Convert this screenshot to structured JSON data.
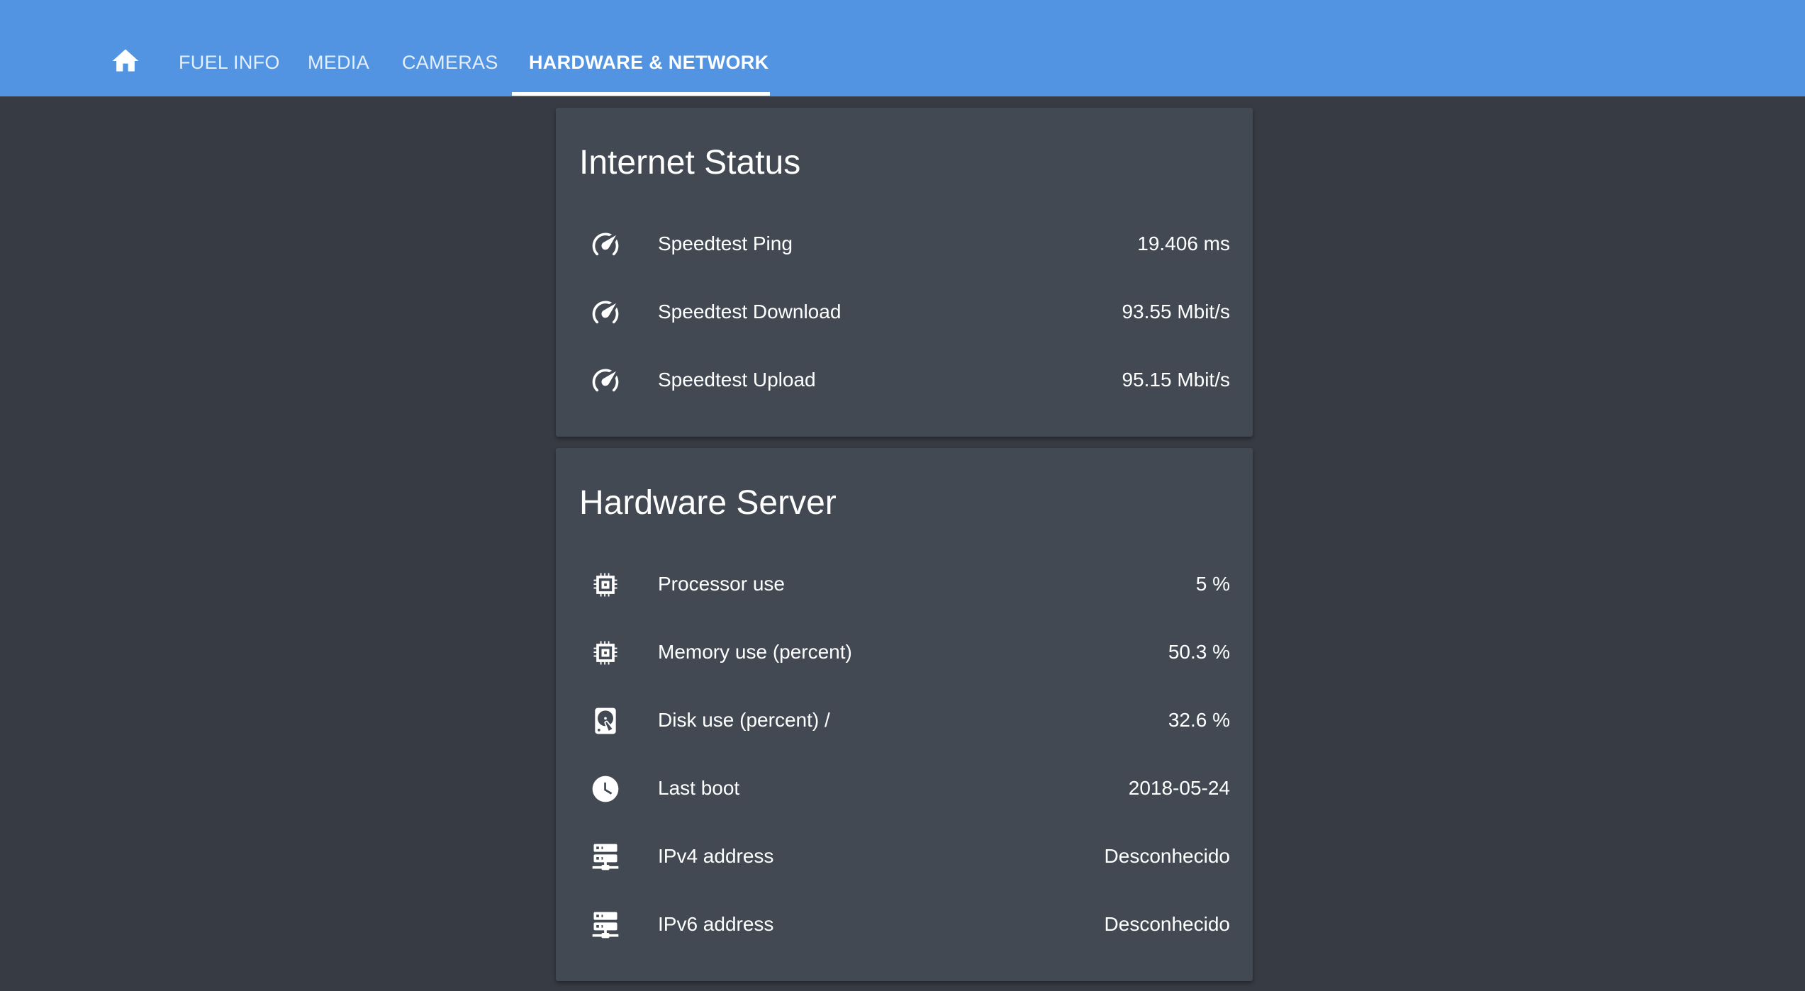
{
  "nav": {
    "home_icon": "home-icon",
    "tabs": [
      {
        "label": "FUEL INFO"
      },
      {
        "label": "MEDIA"
      },
      {
        "label": "CAMERAS"
      },
      {
        "label": "HARDWARE & NETWORK",
        "active": true
      }
    ]
  },
  "colors": {
    "header": "#5294e2",
    "background": "#373b43",
    "card": "#434953"
  },
  "internet_status": {
    "title": "Internet Status",
    "rows": [
      {
        "icon": "speedometer-icon",
        "label": "Speedtest Ping",
        "value": "19.406 ms"
      },
      {
        "icon": "speedometer-icon",
        "label": "Speedtest Download",
        "value": "93.55 Mbit/s"
      },
      {
        "icon": "speedometer-icon",
        "label": "Speedtest Upload",
        "value": "95.15 Mbit/s"
      }
    ]
  },
  "hardware_server": {
    "title": "Hardware Server",
    "rows": [
      {
        "icon": "chip-icon",
        "label": "Processor use",
        "value": "5 %"
      },
      {
        "icon": "chip-icon",
        "label": "Memory use (percent)",
        "value": "50.3 %"
      },
      {
        "icon": "harddisk-icon",
        "label": "Disk use (percent) /",
        "value": "32.6 %"
      },
      {
        "icon": "clock-icon",
        "label": "Last boot",
        "value": "2018-05-24"
      },
      {
        "icon": "server-network-icon",
        "label": "IPv4 address",
        "value": "Desconhecido"
      },
      {
        "icon": "server-network-icon",
        "label": "IPv6 address",
        "value": "Desconhecido"
      }
    ]
  }
}
